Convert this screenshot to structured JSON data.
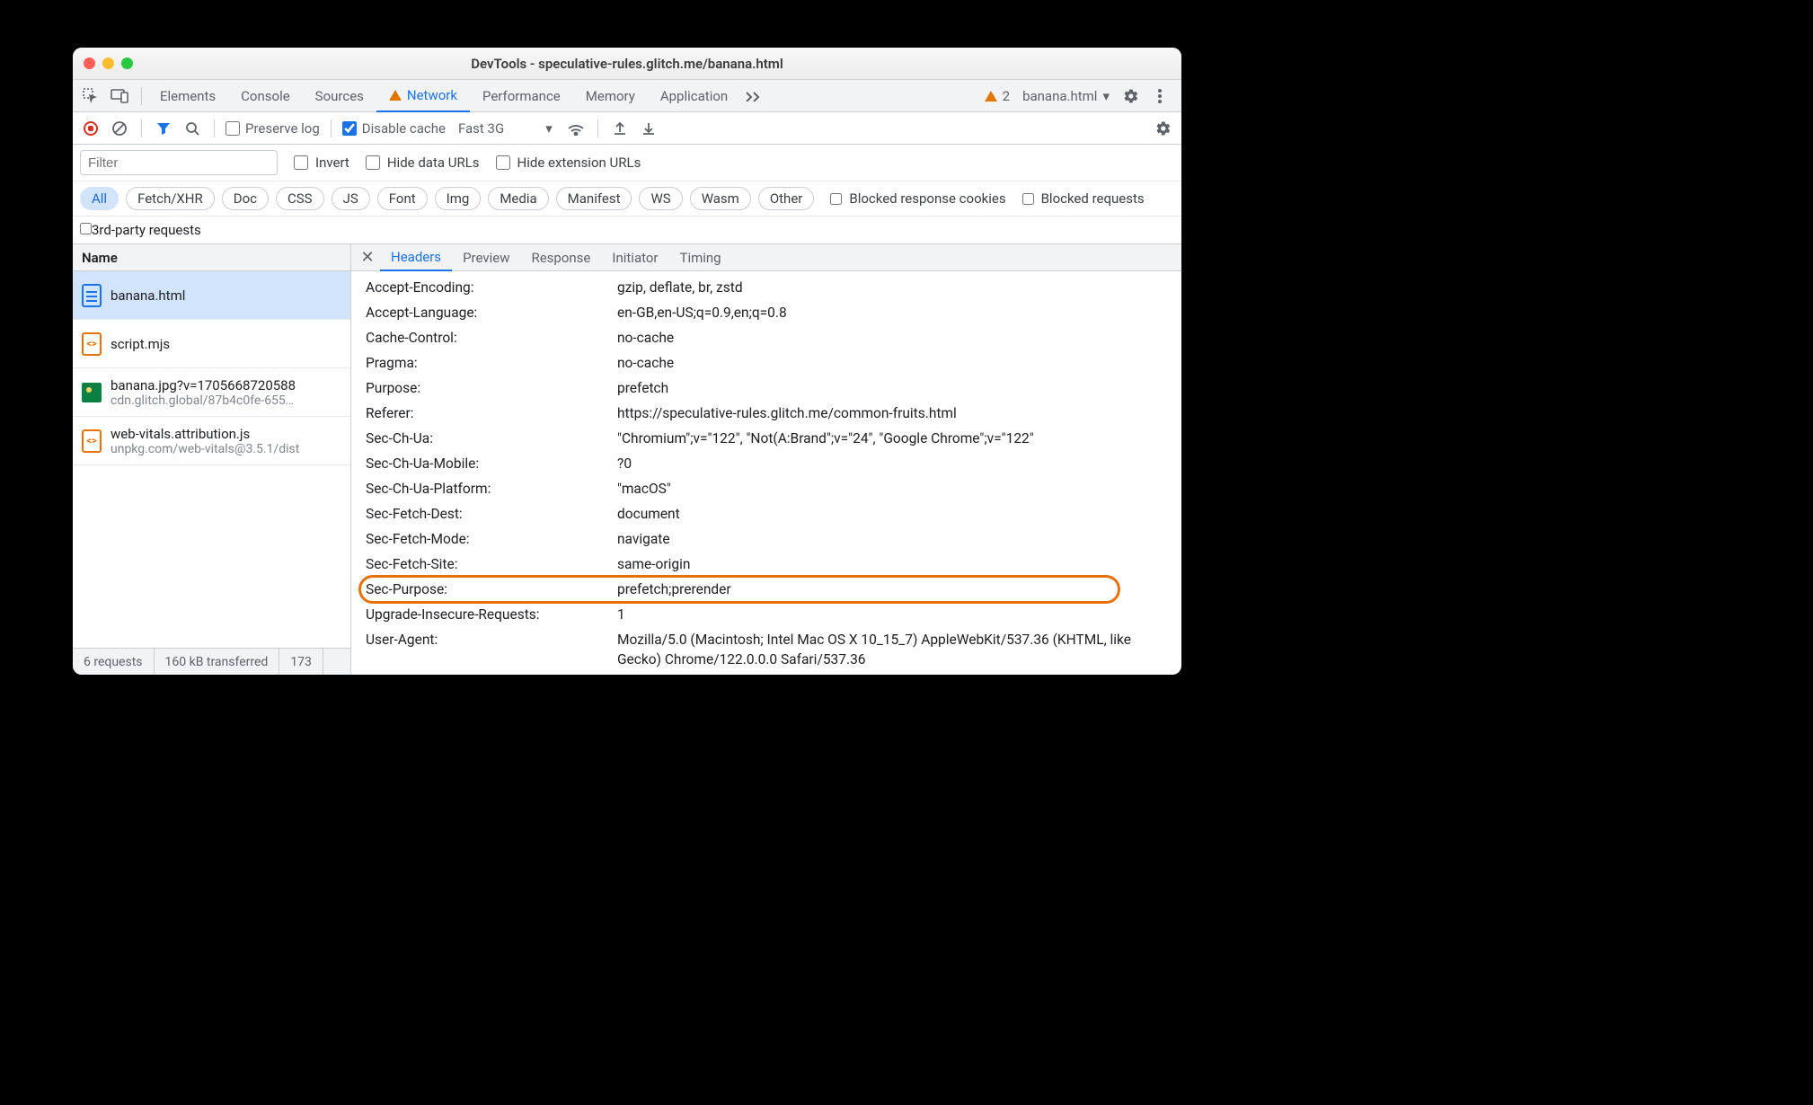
{
  "window": {
    "title": "DevTools - speculative-rules.glitch.me/banana.html"
  },
  "tabs": {
    "items": [
      "Elements",
      "Console",
      "Sources",
      "Network",
      "Performance",
      "Memory",
      "Application"
    ],
    "active": "Network",
    "context_label": "banana.html",
    "warn_count": "2"
  },
  "toolbar": {
    "preserve_log": "Preserve log",
    "disable_cache": "Disable cache",
    "throttle": "Fast 3G"
  },
  "filterbar": {
    "filter_placeholder": "Filter",
    "invert": "Invert",
    "hide_data": "Hide data URLs",
    "hide_ext": "Hide extension URLs"
  },
  "types": {
    "items": [
      "All",
      "Fetch/XHR",
      "Doc",
      "CSS",
      "JS",
      "Font",
      "Img",
      "Media",
      "Manifest",
      "WS",
      "Wasm",
      "Other"
    ],
    "blocked_cookies": "Blocked response cookies",
    "blocked_req": "Blocked requests",
    "thirdparty": "3rd-party requests"
  },
  "reqlist": {
    "header": "Name",
    "items": [
      {
        "name": "banana.html",
        "sub": "",
        "icon": "doc",
        "selected": true
      },
      {
        "name": "script.mjs",
        "sub": "",
        "icon": "js",
        "selected": false
      },
      {
        "name": "banana.jpg?v=1705668720588",
        "sub": "cdn.glitch.global/87b4c0fe-655…",
        "icon": "img",
        "selected": false
      },
      {
        "name": "web-vitals.attribution.js",
        "sub": "unpkg.com/web-vitals@3.5.1/dist",
        "icon": "js",
        "selected": false
      }
    ]
  },
  "status": {
    "requests": "6 requests",
    "transferred": "160 kB transferred",
    "resources": "173"
  },
  "detail": {
    "tabs": [
      "Headers",
      "Preview",
      "Response",
      "Initiator",
      "Timing"
    ],
    "headers": [
      {
        "k": "Accept-Encoding:",
        "v": "gzip, deflate, br, zstd"
      },
      {
        "k": "Accept-Language:",
        "v": "en-GB,en-US;q=0.9,en;q=0.8"
      },
      {
        "k": "Cache-Control:",
        "v": "no-cache"
      },
      {
        "k": "Pragma:",
        "v": "no-cache"
      },
      {
        "k": "Purpose:",
        "v": "prefetch"
      },
      {
        "k": "Referer:",
        "v": "https://speculative-rules.glitch.me/common-fruits.html"
      },
      {
        "k": "Sec-Ch-Ua:",
        "v": "\"Chromium\";v=\"122\", \"Not(A:Brand\";v=\"24\", \"Google Chrome\";v=\"122\""
      },
      {
        "k": "Sec-Ch-Ua-Mobile:",
        "v": "?0"
      },
      {
        "k": "Sec-Ch-Ua-Platform:",
        "v": "\"macOS\""
      },
      {
        "k": "Sec-Fetch-Dest:",
        "v": "document"
      },
      {
        "k": "Sec-Fetch-Mode:",
        "v": "navigate"
      },
      {
        "k": "Sec-Fetch-Site:",
        "v": "same-origin"
      },
      {
        "k": "Sec-Purpose:",
        "v": "prefetch;prerender",
        "hl": true
      },
      {
        "k": "Upgrade-Insecure-Requests:",
        "v": "1"
      },
      {
        "k": "User-Agent:",
        "v": "Mozilla/5.0 (Macintosh; Intel Mac OS X 10_15_7) AppleWebKit/537.36 (KHTML, like Gecko) Chrome/122.0.0.0 Safari/537.36"
      }
    ]
  }
}
